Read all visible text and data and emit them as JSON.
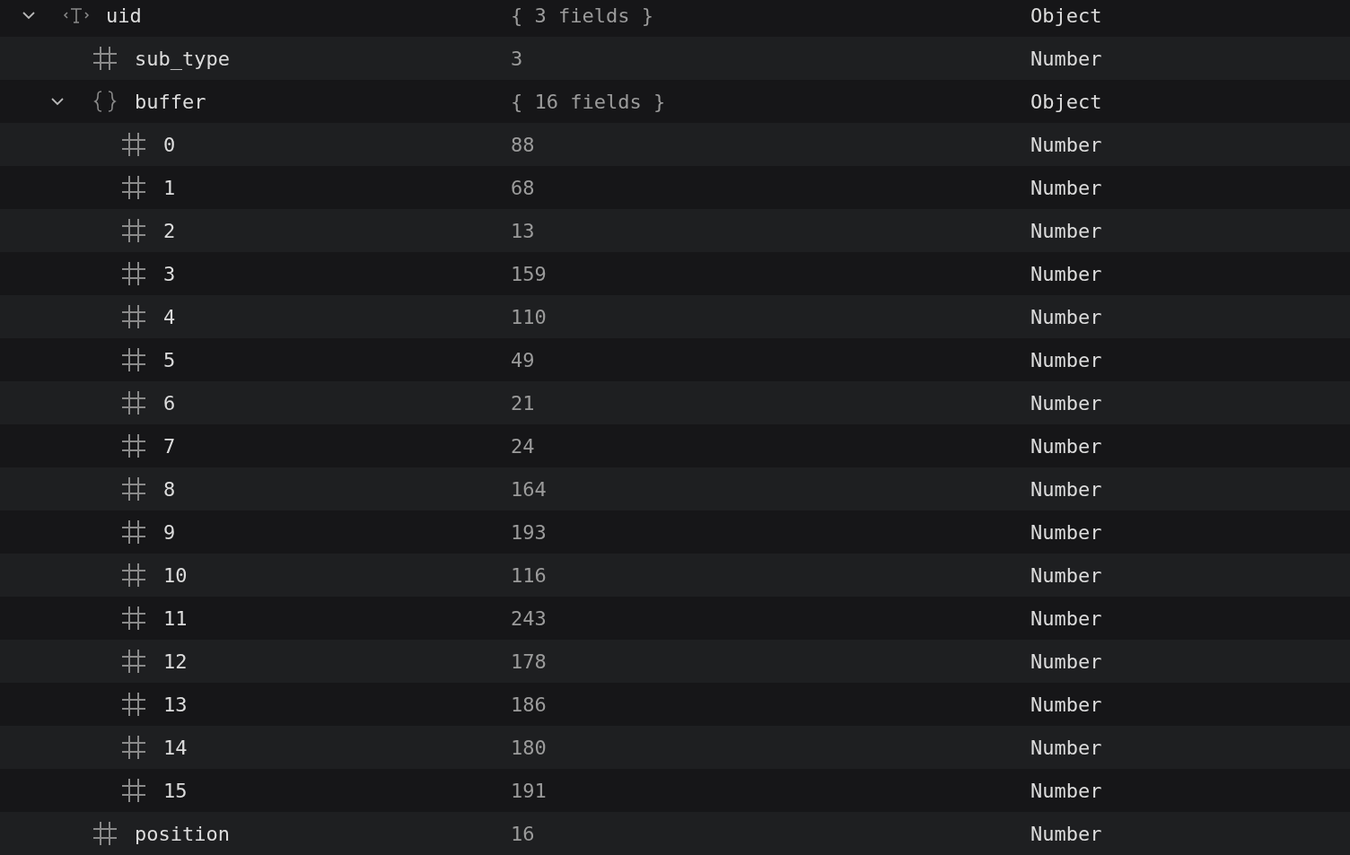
{
  "tree": [
    {
      "kind": "binary",
      "name": "uid",
      "value": "{ 3 fields }",
      "type": "Object",
      "expanded": true,
      "children": [
        {
          "kind": "number",
          "name": "sub_type",
          "value": "3",
          "type": "Number"
        },
        {
          "kind": "object",
          "name": "buffer",
          "value": "{ 16 fields }",
          "type": "Object",
          "expanded": true,
          "children": [
            {
              "kind": "number",
              "name": "0",
              "value": "88",
              "type": "Number"
            },
            {
              "kind": "number",
              "name": "1",
              "value": "68",
              "type": "Number"
            },
            {
              "kind": "number",
              "name": "2",
              "value": "13",
              "type": "Number"
            },
            {
              "kind": "number",
              "name": "3",
              "value": "159",
              "type": "Number"
            },
            {
              "kind": "number",
              "name": "4",
              "value": "110",
              "type": "Number"
            },
            {
              "kind": "number",
              "name": "5",
              "value": "49",
              "type": "Number"
            },
            {
              "kind": "number",
              "name": "6",
              "value": "21",
              "type": "Number"
            },
            {
              "kind": "number",
              "name": "7",
              "value": "24",
              "type": "Number"
            },
            {
              "kind": "number",
              "name": "8",
              "value": "164",
              "type": "Number"
            },
            {
              "kind": "number",
              "name": "9",
              "value": "193",
              "type": "Number"
            },
            {
              "kind": "number",
              "name": "10",
              "value": "116",
              "type": "Number"
            },
            {
              "kind": "number",
              "name": "11",
              "value": "243",
              "type": "Number"
            },
            {
              "kind": "number",
              "name": "12",
              "value": "178",
              "type": "Number"
            },
            {
              "kind": "number",
              "name": "13",
              "value": "186",
              "type": "Number"
            },
            {
              "kind": "number",
              "name": "14",
              "value": "180",
              "type": "Number"
            },
            {
              "kind": "number",
              "name": "15",
              "value": "191",
              "type": "Number"
            }
          ]
        },
        {
          "kind": "number",
          "name": "position",
          "value": "16",
          "type": "Number"
        }
      ]
    }
  ]
}
